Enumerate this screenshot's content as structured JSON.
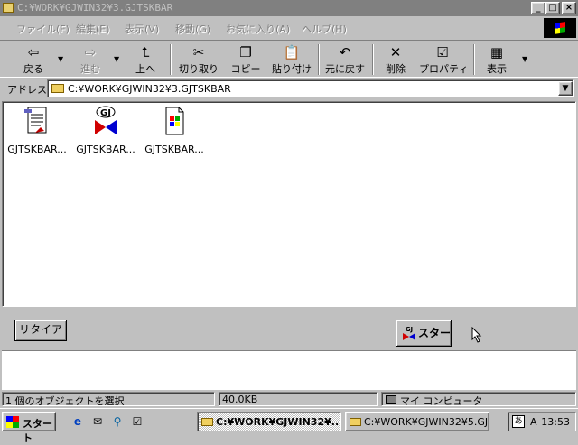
{
  "window": {
    "title": "C:¥WORK¥GJWIN32¥3.GJTSKBAR",
    "controls": {
      "minimize": "_",
      "maximize": "□",
      "close": "×"
    }
  },
  "menu": {
    "items": [
      "ファイル(F)",
      "編集(E)",
      "表示(V)",
      "移動(G)",
      "お気に入り(A)",
      "ヘルプ(H)"
    ]
  },
  "toolbar": {
    "back": "戻る",
    "forward": "進む",
    "up": "上へ",
    "cut": "切り取り",
    "copy": "コピー",
    "paste": "貼り付け",
    "undo": "元に戻す",
    "delete": "削除",
    "properties": "プロパティ",
    "view": "表示"
  },
  "address": {
    "label": "アドレス",
    "value": "C:¥WORK¥GJWIN32¥3.GJTSKBAR"
  },
  "files": [
    {
      "name": "GJTSKBAR...",
      "icon": "text-document-icon"
    },
    {
      "name": "GJTSKBAR...",
      "icon": "gj-application-icon"
    },
    {
      "name": "GJTSKBAR...",
      "icon": "windows-file-icon"
    }
  ],
  "panel": {
    "retire_label": "リタイア",
    "start_label": "スタート",
    "start_logo": "GJ"
  },
  "status": {
    "selection": "1 個のオブジェクトを選択",
    "size": "40.0KB",
    "location": "マイ コンピュータ"
  },
  "taskbar": {
    "start_label": "スタート",
    "tasks": [
      {
        "label": "C:¥WORK¥GJWIN32¥...",
        "active": true
      },
      {
        "label": "C:¥WORK¥GJWIN32¥5.GJ...",
        "active": false
      }
    ],
    "tray_ime": "A",
    "clock": "13:53"
  },
  "colors": {
    "face": "#c0c0c0",
    "title_inactive": "#808080",
    "window": "#ffffff"
  }
}
